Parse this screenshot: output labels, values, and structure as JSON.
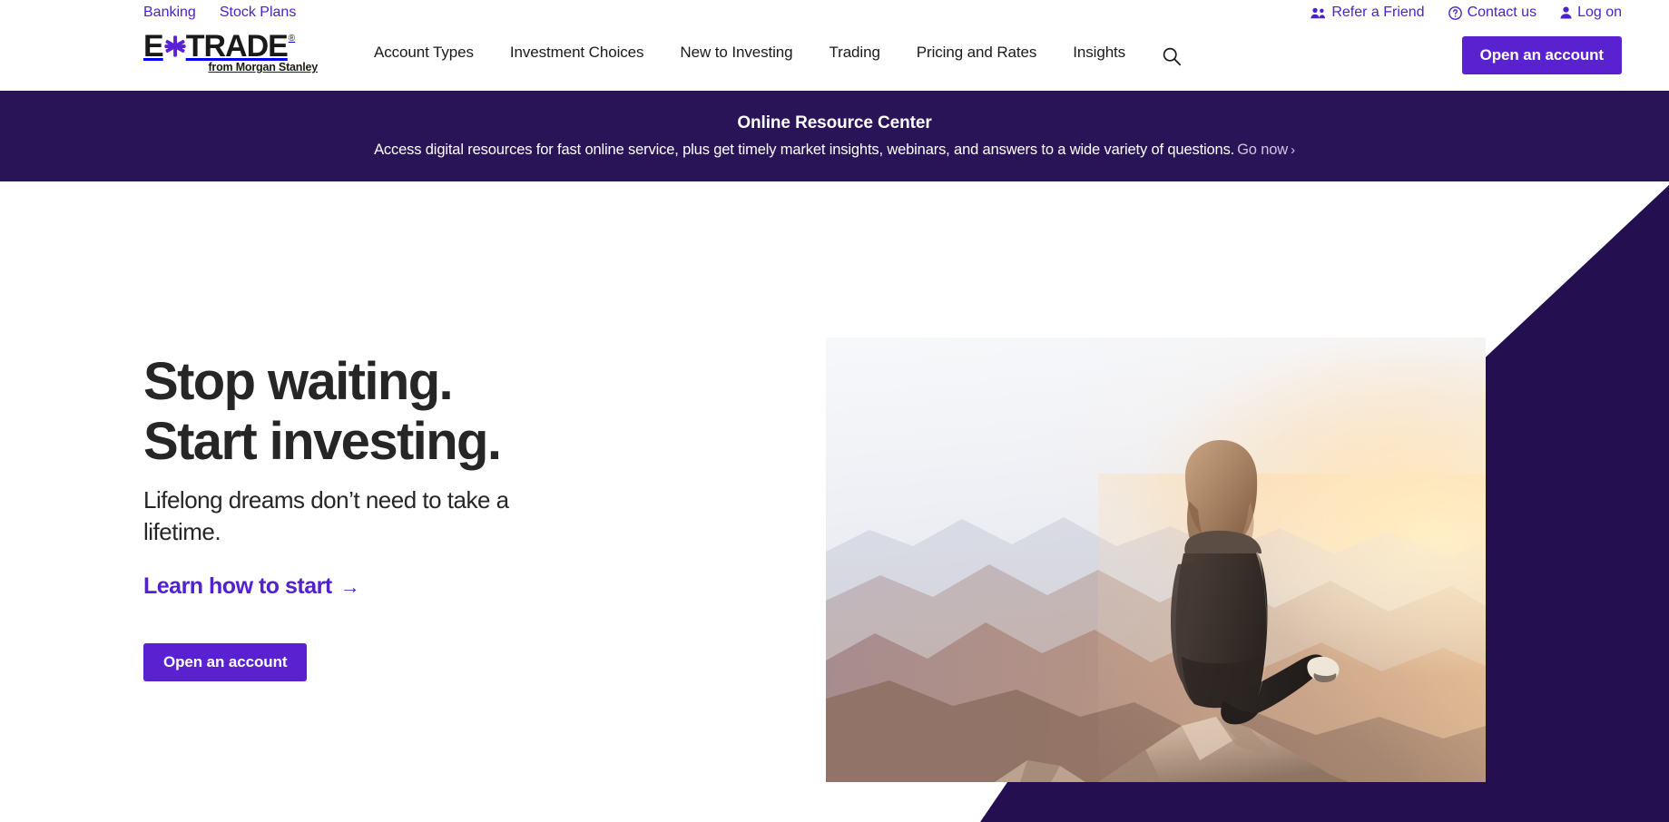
{
  "brand": {
    "accent_purple": "#5921D0",
    "link_purple": "#4B21CB",
    "banner_navy": "#2A1458",
    "text_dark": "#262626"
  },
  "utility_bar": {
    "left_links": [
      {
        "label": "Banking"
      },
      {
        "label": "Stock Plans"
      }
    ],
    "right_links": [
      {
        "label": "Refer a Friend",
        "icon": "people-icon"
      },
      {
        "label": "Contact us",
        "icon": "question-circle-icon"
      },
      {
        "label": "Log on",
        "icon": "person-icon"
      }
    ]
  },
  "header": {
    "logo": {
      "mark_e": "E",
      "mark_star": "asterisk-star-icon",
      "mark_trade": "TRADE",
      "registered": "®",
      "tagline": "from Morgan Stanley"
    },
    "nav": [
      {
        "label": "Account Types"
      },
      {
        "label": "Investment Choices"
      },
      {
        "label": "New to Investing"
      },
      {
        "label": "Trading"
      },
      {
        "label": "Pricing and Rates"
      },
      {
        "label": "Insights"
      }
    ],
    "search_icon": "search-icon",
    "cta_label": "Open an account"
  },
  "promo_banner": {
    "title": "Online Resource Center",
    "description": "Access digital resources for fast online service, plus get timely market insights, webinars, and answers to a wide variety of questions.",
    "link_label": "Go now",
    "link_chevron": "›"
  },
  "hero": {
    "headline_line1": "Stop waiting.",
    "headline_line2": "Start investing.",
    "subhead": "Lifelong dreams don’t need to take a lifetime.",
    "link_label": "Learn how to start",
    "link_arrow": "→",
    "cta_label": "Open an account",
    "image_alt": "Woman sitting on a rocky summit overlooking misty mountains at sunrise"
  }
}
